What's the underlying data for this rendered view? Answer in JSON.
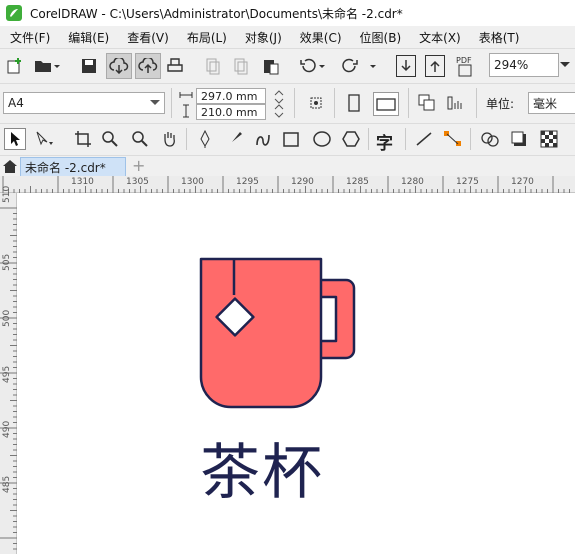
{
  "window": {
    "title": "CorelDRAW - C:\\Users\\Administrator\\Documents\\未命名 -2.cdr*"
  },
  "menu": [
    "文件(F)",
    "编辑(E)",
    "查看(V)",
    "布局(L)",
    "对象(J)",
    "效果(C)",
    "位图(B)",
    "文本(X)",
    "表格(T)"
  ],
  "toolbar": {
    "zoom": "294%"
  },
  "property_bar": {
    "page_size": "A4",
    "width": "297.0 mm",
    "height": "210.0 mm",
    "unit_label": "单位:",
    "unit_value": "毫米"
  },
  "tabs": {
    "document": "未命名 -2.cdr*",
    "add": "+"
  },
  "ruler": {
    "horizontal": [
      "1310",
      "1305",
      "1300",
      "1295",
      "1290",
      "1285",
      "1280",
      "1275",
      "1270"
    ],
    "vertical": [
      "510",
      "505",
      "500",
      "495",
      "490",
      "485"
    ]
  },
  "artwork": {
    "text": "茶杯",
    "mug_color": "#ff6a6a",
    "outline_color": "#1f2350"
  },
  "colors": {
    "chrome": "#f0f0f0",
    "tab_active": "#cfe2f7"
  }
}
